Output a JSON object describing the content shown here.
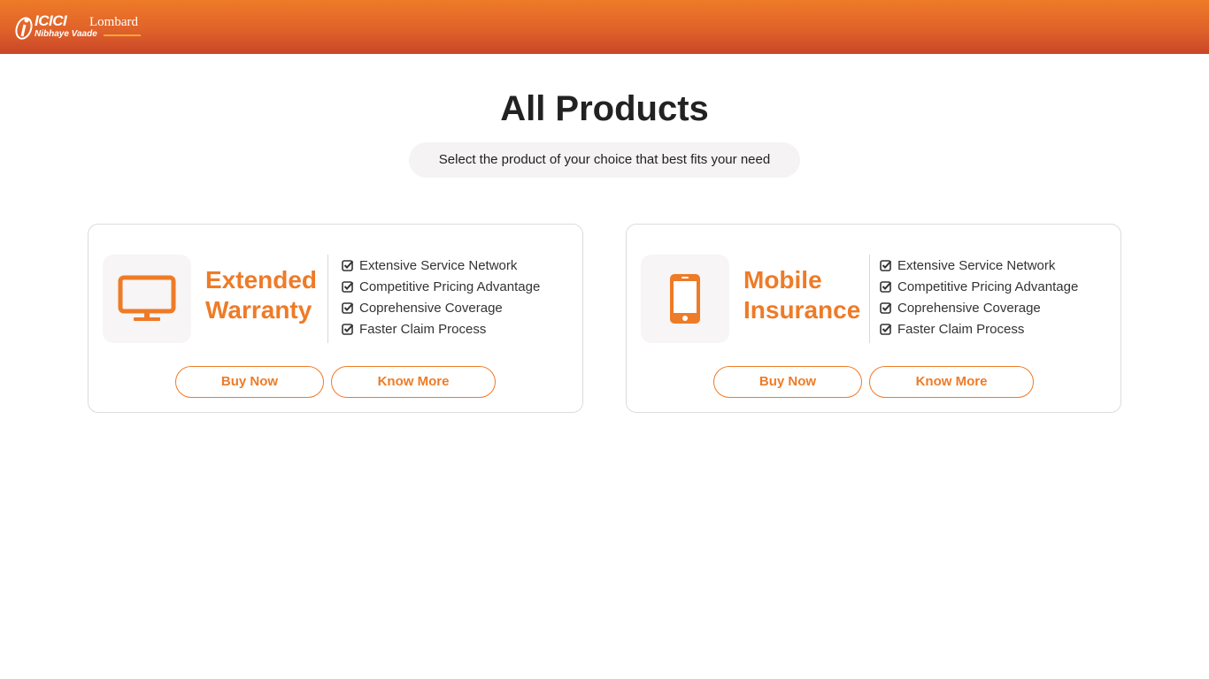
{
  "header": {
    "logo": {
      "brand": "ICICI",
      "brand2": "Lombard",
      "tagline": "Nibhaye Vaade"
    }
  },
  "main": {
    "title": "All Products",
    "subtitle": "Select the product of your choice that best fits your need"
  },
  "products": [
    {
      "icon": "monitor-icon",
      "name_line1": "Extended",
      "name_line2": "Warranty",
      "features": [
        "Extensive Service Network",
        "Competitive Pricing Advantage",
        "Coprehensive Coverage",
        "Faster Claim Process"
      ],
      "buy_label": "Buy Now",
      "know_label": "Know More"
    },
    {
      "icon": "mobile-phone-icon",
      "name_line1": "Mobile",
      "name_line2": "Insurance",
      "features": [
        "Extensive Service Network",
        "Competitive Pricing Advantage",
        "Coprehensive Coverage",
        "Faster Claim Process"
      ],
      "buy_label": "Buy Now",
      "know_label": "Know More"
    }
  ],
  "colors": {
    "accent": "#ee7b27",
    "header_top": "#ee7b27",
    "header_bottom": "#c94628"
  }
}
